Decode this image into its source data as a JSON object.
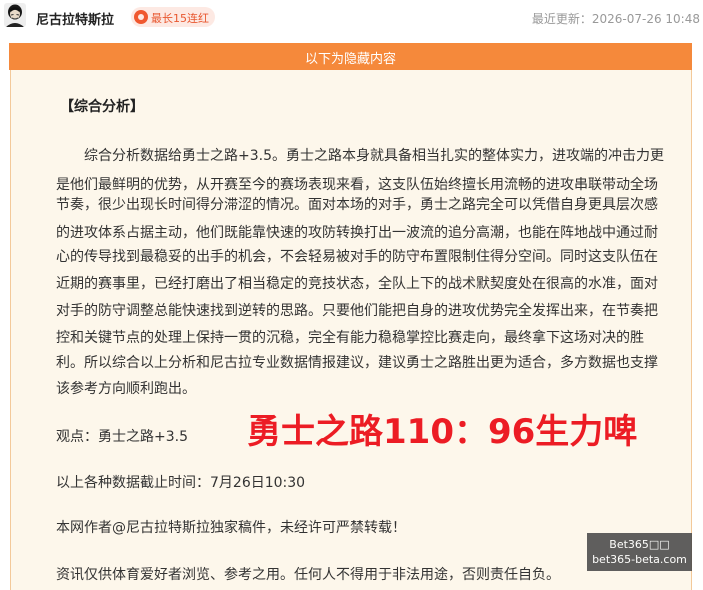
{
  "header": {
    "author": "尼古拉特斯拉",
    "badge": "最长15连红",
    "updated": "最近更新：2026-07-26 10:48"
  },
  "banner": {
    "text": "以下为隐藏内容"
  },
  "content": {
    "section_title": "【综合分析】",
    "lines": [
      "综合分析数据给勇士之路+3.5。勇士之路本身就具备相当扎实的整体实力，进攻端的冲击力更",
      "是他们最鲜明的优势，从开赛至今的赛场表现来看，这支队伍始终擅长用流畅的进攻串联带动全场",
      "节奏，很少出现长时间得分滞涩的情况。面对本场的对手，勇士之路完全可以凭借自身更具层次感",
      "的进攻体系占据主动，他们既能靠快速的攻防转换打出一波流的追分高潮，也能在阵地战中通过耐",
      "心的传导找到最稳妥的出手的机会，不会轻易被对手的防守布置限制住得分空间。同时这支队伍在",
      "近期的赛事里，已经打磨出了相当稳定的竞技状态，全队上下的战术默契度处在很高的水准，面对",
      "对手的防守调整总能快速找到逆转的思路。只要他们能把自身的进攻优势完全发挥出来，在节奏把",
      "控和关键节点的处理上保持一贯的沉稳，完全有能力稳稳掌控比赛走向，最终拿下这场对决的胜",
      "利。所以综合以上分析和尼古拉专业数据情报建议，建议勇士之路胜出更为适合，多方数据也支撑",
      "该参考方向顺利跑出。"
    ],
    "viewpoint": "观点：勇士之路+3.5",
    "score_overlay": "勇士之路110：96生力啤",
    "cutoff": "以上各种数据截止时间：7月26日10:30",
    "copyright": "本网作者@尼古拉特斯拉独家稿件，未经许可严禁转载！",
    "disclaimer": "资讯仅供体育爱好者浏览、参考之用。任何人不得用于非法用途，否则责任自负。"
  },
  "watermark": {
    "line1": "Bet365□□",
    "line2": "bet365-beta.com"
  },
  "colors": {
    "accent": "#f5893b",
    "highlight": "#ec1c24",
    "panel_bg": "#fdf7eb"
  }
}
